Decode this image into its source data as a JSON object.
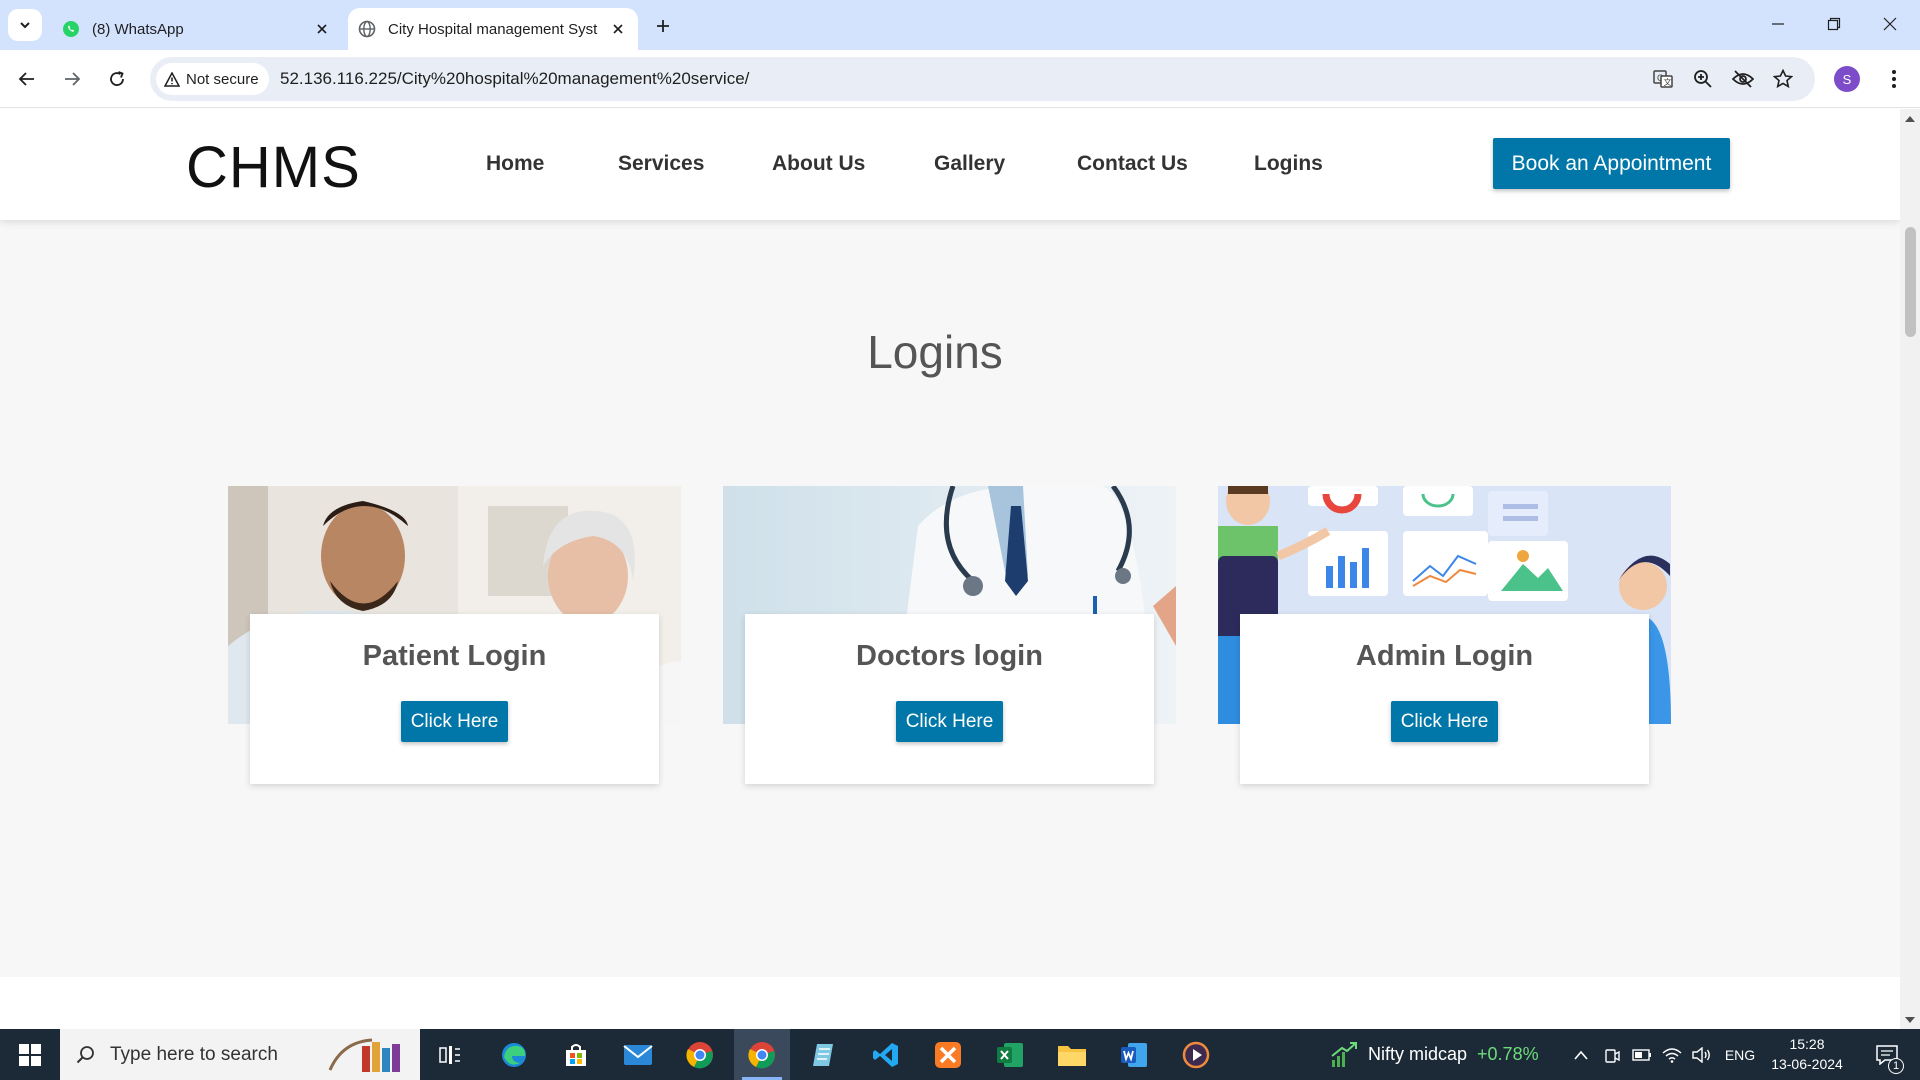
{
  "browser": {
    "tabs": [
      {
        "title": "(8) WhatsApp",
        "active": false
      },
      {
        "title": "City Hospital management Syst",
        "active": true
      }
    ],
    "security_label": "Not secure",
    "url": "52.136.116.225/City%20hospital%20management%20service/",
    "profile_initial": "S"
  },
  "site": {
    "logo": "CHMS",
    "nav": [
      "Home",
      "Services",
      "About Us",
      "Gallery",
      "Contact Us",
      "Logins"
    ],
    "cta_label": "Book an Appointment",
    "section_title": "Logins",
    "cards": [
      {
        "title": "Patient Login",
        "button": "Click Here"
      },
      {
        "title": "Doctors login",
        "button": "Click Here"
      },
      {
        "title": "Admin Login",
        "button": "Click Here"
      }
    ],
    "accent_color": "#0077a8"
  },
  "taskbar": {
    "search_placeholder": "Type here to search",
    "ticker_name": "Nifty midcap",
    "ticker_change": "+0.78%",
    "language": "ENG",
    "time": "15:28",
    "date": "13-06-2024",
    "notification_count": "1",
    "pinned_apps": [
      "task-view",
      "edge",
      "store",
      "mail",
      "chrome",
      "chrome",
      "notepad",
      "vscode",
      "xampp",
      "excel",
      "file-explorer",
      "word",
      "media-player"
    ]
  }
}
